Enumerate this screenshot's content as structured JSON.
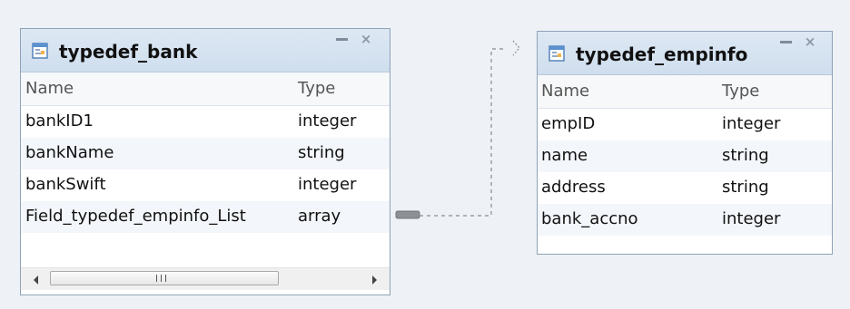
{
  "bank": {
    "title": "typedef_bank",
    "columns": {
      "name": "Name",
      "type": "Type"
    },
    "rows": [
      {
        "name": "bankID1",
        "type": "integer"
      },
      {
        "name": "bankName",
        "type": "string"
      },
      {
        "name": "bankSwift",
        "type": "integer"
      },
      {
        "name": "Field_typedef_empinfo_List",
        "type": "array"
      }
    ]
  },
  "empinfo": {
    "title": "typedef_empinfo",
    "columns": {
      "name": "Name",
      "type": "Type"
    },
    "rows": [
      {
        "name": "empID",
        "type": "integer"
      },
      {
        "name": "name",
        "type": "string"
      },
      {
        "name": "address",
        "type": "string"
      },
      {
        "name": "bank_accno",
        "type": "integer"
      }
    ]
  },
  "icons": {
    "entity": "table-icon",
    "minimize": "minimize-icon",
    "close": "close-icon",
    "scroll_left": "scroll-left-icon",
    "scroll_right": "scroll-right-icon",
    "scroll_grip": "scroll-grip-icon"
  },
  "colors": {
    "background": "#eef2f6",
    "border": "#8ea2b8",
    "header": "#d6e3f1",
    "connector": "#8a8a8a"
  }
}
